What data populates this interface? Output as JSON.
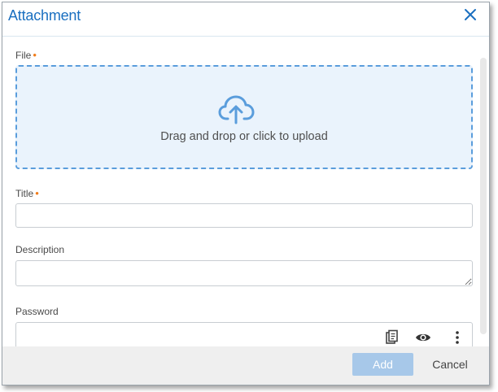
{
  "dialog": {
    "title": "Attachment",
    "close_icon": "close-icon"
  },
  "colors": {
    "title": "#1a6fc0",
    "required_marker": "#f07c1a",
    "dropzone_bg": "#eaf3fc",
    "dropzone_border": "#5a9ddc",
    "add_button_bg": "#a7c8e9",
    "footer_bg": "#efefef"
  },
  "file": {
    "label": "File",
    "required_marker": "•",
    "dropzone_icon": "cloud-upload-icon",
    "dropzone_text": "Drag and drop or click to upload"
  },
  "title_field": {
    "label": "Title",
    "required_marker": "•",
    "value": ""
  },
  "description": {
    "label": "Description",
    "value": ""
  },
  "password": {
    "label": "Password",
    "value": "",
    "icons": [
      "clipboard-icon",
      "eye-icon",
      "more-vertical-icon"
    ]
  },
  "footer": {
    "add_label": "Add",
    "cancel_label": "Cancel"
  }
}
